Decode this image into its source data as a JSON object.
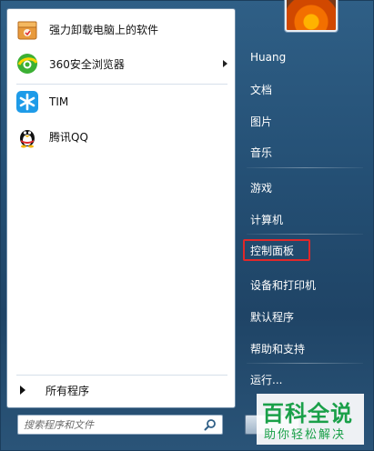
{
  "pinned_programs": [
    {
      "label": "强力卸载电脑上的软件",
      "icon": "uninstall-box-icon",
      "has_submenu": false
    },
    {
      "label": "360安全浏览器",
      "icon": "360-browser-icon",
      "has_submenu": true
    }
  ],
  "recent_programs": [
    {
      "label": "TIM",
      "icon": "tim-icon"
    },
    {
      "label": "腾讯QQ",
      "icon": "qq-penguin-icon"
    }
  ],
  "all_programs_label": "所有程序",
  "search": {
    "placeholder": "搜索程序和文件"
  },
  "right_pane": {
    "user_name": "Huang",
    "items": [
      "文档",
      "图片",
      "音乐",
      "游戏",
      "计算机",
      "控制面板",
      "设备和打印机",
      "默认程序",
      "帮助和支持",
      "运行..."
    ],
    "highlighted_item": "控制面板"
  },
  "watermark": {
    "title": "百科全说",
    "subtitle": "助你轻松解决"
  },
  "colors": {
    "highlight_border": "#e0282a",
    "watermark_green": "#1aa049",
    "menu_blue": "#244f74"
  }
}
